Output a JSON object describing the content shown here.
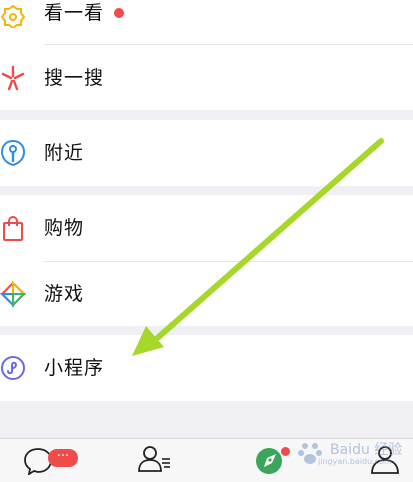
{
  "groups": [
    {
      "items": [
        {
          "label": "看一看",
          "icon": "kanyikan-icon",
          "has_dot": true
        },
        {
          "label": "搜一搜",
          "icon": "souyisou-icon"
        }
      ]
    },
    {
      "items": [
        {
          "label": "附近",
          "icon": "nearby-icon"
        }
      ]
    },
    {
      "items": [
        {
          "label": "购物",
          "icon": "shopping-bag-icon"
        },
        {
          "label": "游戏",
          "icon": "game-icon"
        }
      ]
    },
    {
      "items": [
        {
          "label": "小程序",
          "icon": "mini-program-icon"
        }
      ]
    }
  ],
  "tabbar": {
    "chats_badge": "···",
    "tabs": [
      {
        "icon": "chat-bubble-icon"
      },
      {
        "icon": "contacts-icon"
      },
      {
        "icon": "discover-compass-icon"
      },
      {
        "icon": "me-person-icon"
      }
    ]
  },
  "watermark": {
    "text": "Baidu 经验",
    "sub": "jingyan.baidu.com"
  },
  "colors": {
    "accent_red": "#f04a4a",
    "arrow_green": "#a6d82c",
    "background": "#efeff4"
  }
}
